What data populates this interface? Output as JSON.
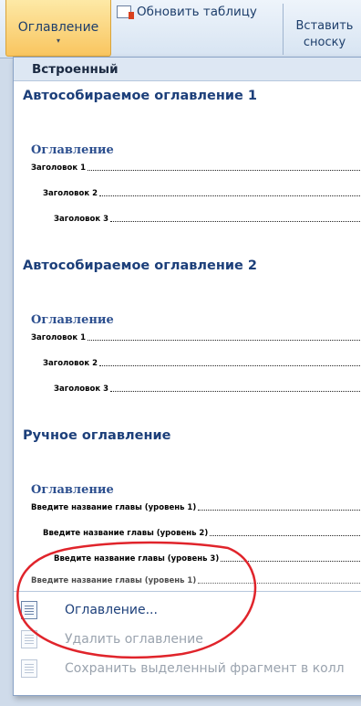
{
  "ribbon": {
    "toc_button_label": "Оглавление",
    "toc_caret": "▾",
    "update_table_label": "Обновить таблицу",
    "insert_footnote_line1": "Вставить",
    "insert_footnote_line2": "сноску"
  },
  "menu": {
    "section_header": "Встроенный",
    "galleries": [
      {
        "title": "Автособираемое оглавление 1",
        "preview_heading": "Оглавление",
        "entries": [
          "Заголовок 1",
          "Заголовок 2",
          "Заголовок 3"
        ]
      },
      {
        "title": "Автособираемое оглавление 2",
        "preview_heading": "Оглавление",
        "entries": [
          "Заголовок 1",
          "Заголовок 2",
          "Заголовок 3"
        ]
      },
      {
        "title": "Ручное оглавление",
        "preview_heading": "Оглавление",
        "entries": [
          "Введите название главы (уровень 1)",
          "Введите название главы (уровень 2)",
          "Введите название главы (уровень 3)",
          "Введите название главы (уровень 1)"
        ]
      }
    ],
    "commands": [
      {
        "label": "Оглавление...",
        "icon": "toc-document-icon",
        "enabled": true
      },
      {
        "label": "Удалить оглавление",
        "icon": "delete-toc-icon",
        "enabled": false
      },
      {
        "label": "Сохранить выделенный фрагмент в колл",
        "icon": "save-selection-icon",
        "enabled": false
      }
    ]
  },
  "colors": {
    "accent": "#1c3f7a",
    "preview_heading": "#2c4f8f",
    "annotation_ring": "#e0242b",
    "hover_highlight": "#f9c55f"
  }
}
